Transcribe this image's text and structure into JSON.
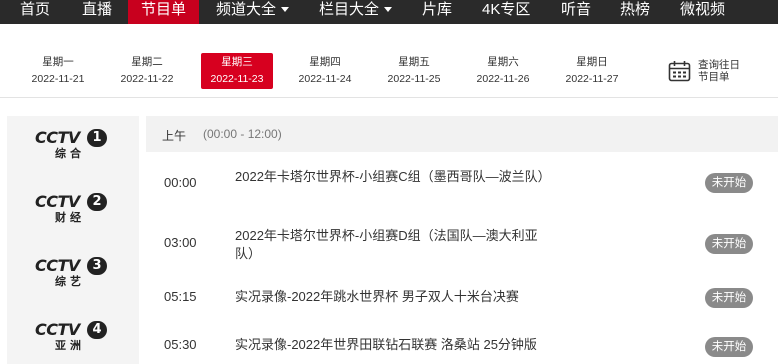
{
  "nav": {
    "items": [
      {
        "label": "首页",
        "dropdown": false,
        "active": false
      },
      {
        "label": "直播",
        "dropdown": false,
        "active": false
      },
      {
        "label": "节目单",
        "dropdown": false,
        "active": true
      },
      {
        "label": "频道大全",
        "dropdown": true,
        "active": false
      },
      {
        "label": "栏目大全",
        "dropdown": true,
        "active": false
      },
      {
        "label": "片库",
        "dropdown": false,
        "active": false
      },
      {
        "label": "4K专区",
        "dropdown": false,
        "active": false
      },
      {
        "label": "听音",
        "dropdown": false,
        "active": false
      },
      {
        "label": "热榜",
        "dropdown": false,
        "active": false
      },
      {
        "label": "微视频",
        "dropdown": false,
        "active": false
      }
    ],
    "active_color": "#c8001e"
  },
  "dates": {
    "days": [
      {
        "weekday": "星期一",
        "date": "2022-11-21",
        "active": false
      },
      {
        "weekday": "星期二",
        "date": "2022-11-22",
        "active": false
      },
      {
        "weekday": "星期三",
        "date": "2022-11-23",
        "active": true
      },
      {
        "weekday": "星期四",
        "date": "2022-11-24",
        "active": false
      },
      {
        "weekday": "星期五",
        "date": "2022-11-25",
        "active": false
      },
      {
        "weekday": "星期六",
        "date": "2022-11-26",
        "active": false
      },
      {
        "weekday": "星期日",
        "date": "2022-11-27",
        "active": false
      }
    ],
    "history_label_line1": "查询往日",
    "history_label_line2": "节目单",
    "history_icon": "calendar-icon"
  },
  "channels": [
    {
      "logo_text": "CCTV",
      "number": "1",
      "name": "综合"
    },
    {
      "logo_text": "CCTV",
      "number": "2",
      "name": "财经"
    },
    {
      "logo_text": "CCTV",
      "number": "3",
      "name": "综艺"
    },
    {
      "logo_text": "CCTV",
      "number": "4",
      "name": "亚洲"
    }
  ],
  "schedule": {
    "period_label": "上午",
    "period_range": "(00:00 - 12:00)",
    "programs": [
      {
        "time": "00:00",
        "title": "2022年卡塔尔世界杯-小组赛C组（墨西哥队—波兰队）",
        "status": "未开始"
      },
      {
        "time": "03:00",
        "title": "2022年卡塔尔世界杯-小组赛D组（法国队—澳大利亚队）",
        "status": "未开始"
      },
      {
        "time": "05:15",
        "title": "实况录像-2022年跳水世界杯 男子双人十米台决赛",
        "status": "未开始"
      },
      {
        "time": "05:30",
        "title": "实况录像-2022年世界田联钻石联赛 洛桑站 25分钟版",
        "status": "未开始"
      }
    ]
  }
}
